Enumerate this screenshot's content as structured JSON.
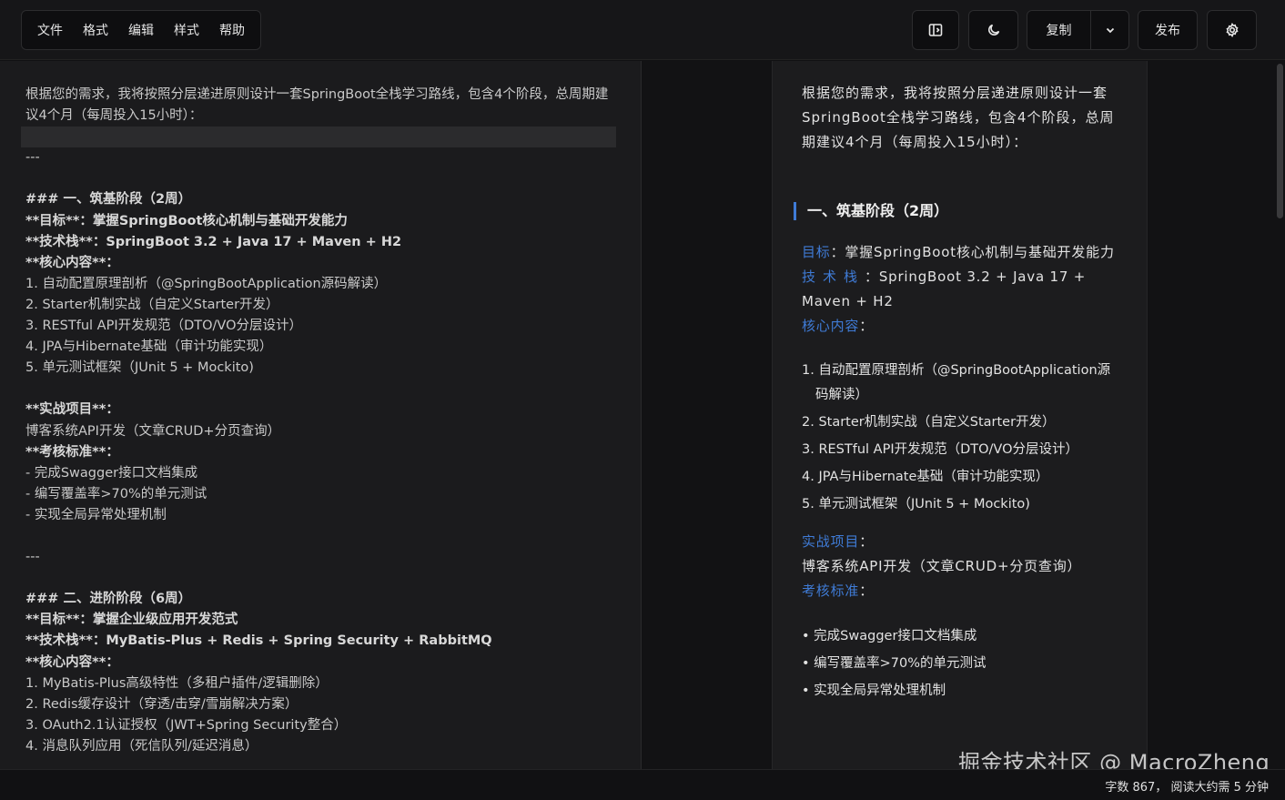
{
  "menu": {
    "items": [
      "文件",
      "格式",
      "编辑",
      "样式",
      "帮助"
    ]
  },
  "toolbar": {
    "sidebar_toggle_icon": "sidebar-panel-icon",
    "theme_icon": "moon-icon",
    "copy_label": "复制",
    "copy_dropdown_icon": "chevron-down-icon",
    "publish_label": "发布",
    "settings_icon": "gear-icon"
  },
  "editor": {
    "lines": [
      "根据您的需求，我将按照分层递进原则设计一套SpringBoot全栈学习路线，包含4个阶段，总周期建议4个月（每周投入15小时）：",
      "",
      "---",
      "",
      "### 一、筑基阶段（2周）",
      "**目标**：掌握SpringBoot核心机制与基础开发能力",
      "**技术栈**：SpringBoot 3.2 + Java 17 + Maven + H2",
      "**核心内容**：",
      "1. 自动配置原理剖析（@SpringBootApplication源码解读）",
      "2. Starter机制实战（自定义Starter开发）",
      "3. RESTful API开发规范（DTO/VO分层设计）",
      "4. JPA与Hibernate基础（审计功能实现）",
      "5. 单元测试框架（JUnit 5 + Mockito)",
      "",
      "**实战项目**：",
      "博客系统API开发（文章CRUD+分页查询）",
      "**考核标准**：",
      "- 完成Swagger接口文档集成",
      "- 编写覆盖率>70%的单元测试",
      "- 实现全局异常处理机制",
      "",
      "---",
      "",
      "### 二、进阶阶段（6周）",
      "**目标**：掌握企业级应用开发范式",
      "**技术栈**：MyBatis-Plus + Redis + Spring Security + RabbitMQ",
      "**核心内容**：",
      "1. MyBatis-Plus高级特性（多租户插件/逻辑删除）",
      "2. Redis缓存设计（穿透/击穿/雪崩解决方案）",
      "3. OAuth2.1认证授权（JWT+Spring Security整合）",
      "4. 消息队列应用（死信队列/延迟消息）"
    ]
  },
  "preview": {
    "intro": "根据您的需求，我将按照分层递进原则设计一套SpringBoot全栈学习路线，包含4个阶段，总周期建议4个月（每周投入15小时）：",
    "heading": "一、筑基阶段（2周）",
    "goal_label": "目标",
    "goal_text": "：掌握SpringBoot核心机制与基础开发能力",
    "stack_label": "技术栈",
    "stack_text": "：SpringBoot 3.2 + Java 17 + Maven + H2",
    "content_label": "核心内容",
    "content_colon": "：",
    "content_items": [
      "1. 自动配置原理剖析（@SpringBootApplication源码解读）",
      "2. Starter机制实战（自定义Starter开发）",
      "3. RESTful API开发规范（DTO/VO分层设计）",
      "4. JPA与Hibernate基础（审计功能实现）",
      "5. 单元测试框架（JUnit 5 + Mockito)"
    ],
    "project_label": "实战项目",
    "project_colon": "：",
    "project_text": "博客系统API开发（文章CRUD+分页查询）",
    "exam_label": "考核标准",
    "exam_colon": "：",
    "exam_items": [
      "• 完成Swagger接口文档集成",
      "• 编写覆盖率>70%的单元测试",
      "• 实现全局异常处理机制"
    ]
  },
  "watermark": "掘金技术社区 @ MacroZheng",
  "status": {
    "text": "字数 867， 阅读大约需 5 分钟"
  }
}
